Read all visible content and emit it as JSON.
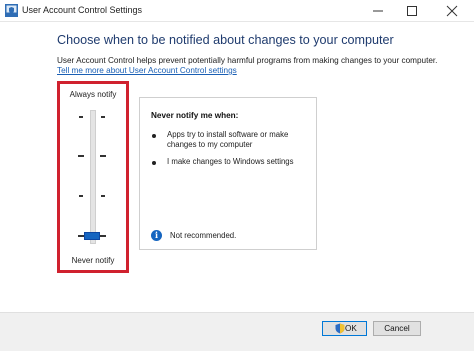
{
  "window": {
    "title": "User Account Control Settings"
  },
  "main": {
    "heading": "Choose when to be notified about changes to your computer",
    "description": "User Account Control helps prevent potentially harmful programs from making changes to your computer.",
    "link": "Tell me more about User Account Control settings"
  },
  "slider": {
    "top_label": "Always notify",
    "bottom_label": "Never notify",
    "levels": 4,
    "selected_level": 1,
    "accent_color": "#1565c0"
  },
  "info": {
    "title": "Never notify me when:",
    "bullets": [
      "Apps try to install software or make changes to my computer",
      "I make changes to Windows settings"
    ],
    "note": "Not recommended."
  },
  "buttons": {
    "ok": "OK",
    "cancel": "Cancel"
  },
  "colors": {
    "highlight_border": "#d0212e",
    "heading": "#1f3b6e",
    "link": "#1a5fb4"
  }
}
